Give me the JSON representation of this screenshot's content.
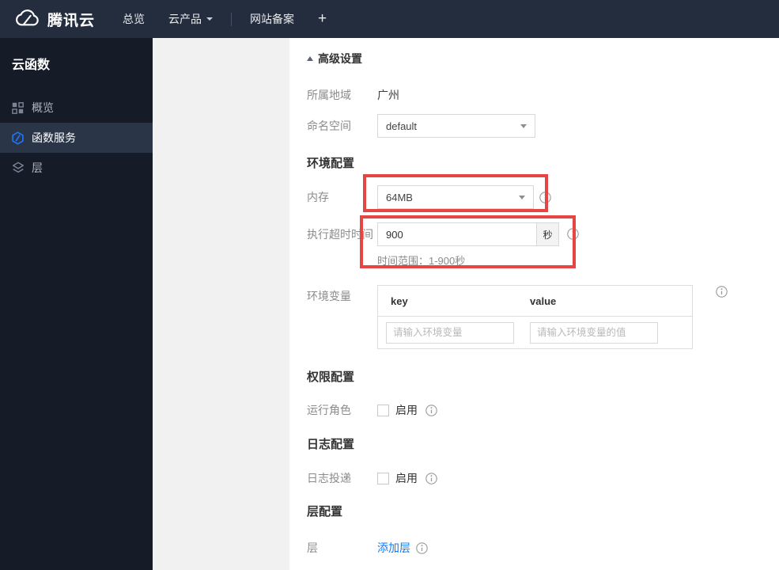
{
  "topbar": {
    "brand": "腾讯云",
    "nav_overview": "总览",
    "nav_products": "云产品",
    "nav_icp": "网站备案",
    "nav_plus": "+"
  },
  "sidebar": {
    "title": "云函数",
    "items": {
      "overview": "概览",
      "function_service": "函数服务",
      "layer": "层"
    }
  },
  "form": {
    "advanced_title": "高级设置",
    "region": {
      "label": "所属地域",
      "value": "广州"
    },
    "namespace": {
      "label": "命名空间",
      "value": "default"
    },
    "env_section": "环境配置",
    "memory": {
      "label": "内存",
      "value": "64MB"
    },
    "timeout": {
      "label": "执行超时时间",
      "value": "900",
      "unit": "秒",
      "hint": "时间范围：1-900秒"
    },
    "env_vars": {
      "label": "环境变量",
      "key_header": "key",
      "value_header": "value",
      "key_placeholder": "请输入环境变量",
      "value_placeholder": "请输入环境变量的值"
    },
    "permission_section": "权限配置",
    "run_role": {
      "label": "运行角色",
      "enable_label": "启用"
    },
    "log_section": "日志配置",
    "log_delivery": {
      "label": "日志投递",
      "enable_label": "启用"
    },
    "layer_section": "层配置",
    "layer": {
      "label": "层",
      "add_link": "添加层"
    }
  },
  "colors": {
    "topbar_bg": "#242d3e",
    "sidebar_bg": "#151b27",
    "sidebar_active_bg": "#2b3548",
    "accent_blue": "#0a7eff",
    "function_icon_blue": "#2177f2",
    "highlight_red": "#e74444"
  }
}
